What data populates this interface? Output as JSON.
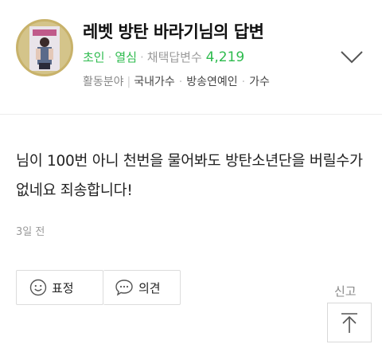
{
  "author": {
    "name": "레벳 방탄 바라기님의 답변",
    "rank": "초인",
    "specialty": "열심",
    "adopted_label": "채택답변수",
    "adopted_count": "4,219"
  },
  "fields": {
    "label": "활동분야",
    "items": [
      "국내가수",
      "방송연예인",
      "가수"
    ]
  },
  "answer": {
    "text": "님이 100번 아니 천번을 물어봐도 방탄소년단을 버릴수가 없네요 죄송합니다!",
    "time": "3일 전"
  },
  "actions": {
    "emoji_label": "표정",
    "comment_label": "의견",
    "report_label": "신고"
  },
  "colors": {
    "accent": "#2ebb4e",
    "muted": "#9a9a9a"
  },
  "icons": {
    "expand": "chevron-down-icon",
    "emoji": "smiley-icon",
    "comment": "speech-bubble-icon",
    "top": "arrow-up-icon"
  }
}
